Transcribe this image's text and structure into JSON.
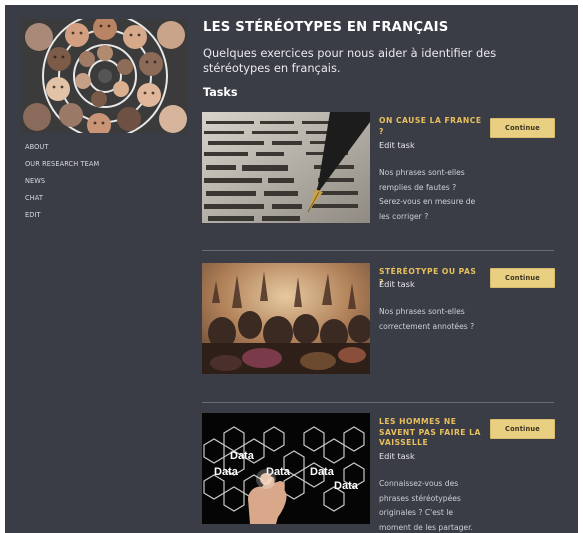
{
  "sidebar": {
    "logo_alt": "logo",
    "nav": [
      {
        "label": "ABOUT"
      },
      {
        "label": "OUR RESEARCH TEAM"
      },
      {
        "label": "NEWS"
      },
      {
        "label": "CHAT"
      },
      {
        "label": "EDIT"
      }
    ]
  },
  "header": {
    "title": "LES STÉRÉOTYPES EN FRANÇAIS",
    "subtitle": "Quelques exercices pour nous aider à identifier des stéréotypes en français.",
    "section": "Tasks"
  },
  "tasks": [
    {
      "title": "ON CAUSE LA FRANCE ?",
      "edit": "Edit task",
      "description": "Nos phrases sont-elles remplies de fautes ? Serez-vous en mesure de les corriger ?",
      "button": "Continue",
      "image": "dictionary-pen-image"
    },
    {
      "title": "STÉRÉOTYPE OU PAS ?",
      "edit": "Edit task",
      "description": "Nos phrases sont-elles correctement annotées ?",
      "button": "Continue",
      "image": "crowd-image"
    },
    {
      "title": "LES HOMMES NE SAVENT PAS FAIRE LA VAISSELLE",
      "edit": "Edit task",
      "description": "Connaissez-vous des phrases stéréotypées originales ? C'est le moment de les partager.",
      "button": "Continue",
      "image": "data-hexagon-image",
      "image_words": [
        "Data",
        "Data",
        "Data",
        "Data",
        "Data"
      ]
    }
  ],
  "colors": {
    "background": "#3a3c46",
    "accent": "#e8c15e",
    "button": "#e9cf82"
  }
}
